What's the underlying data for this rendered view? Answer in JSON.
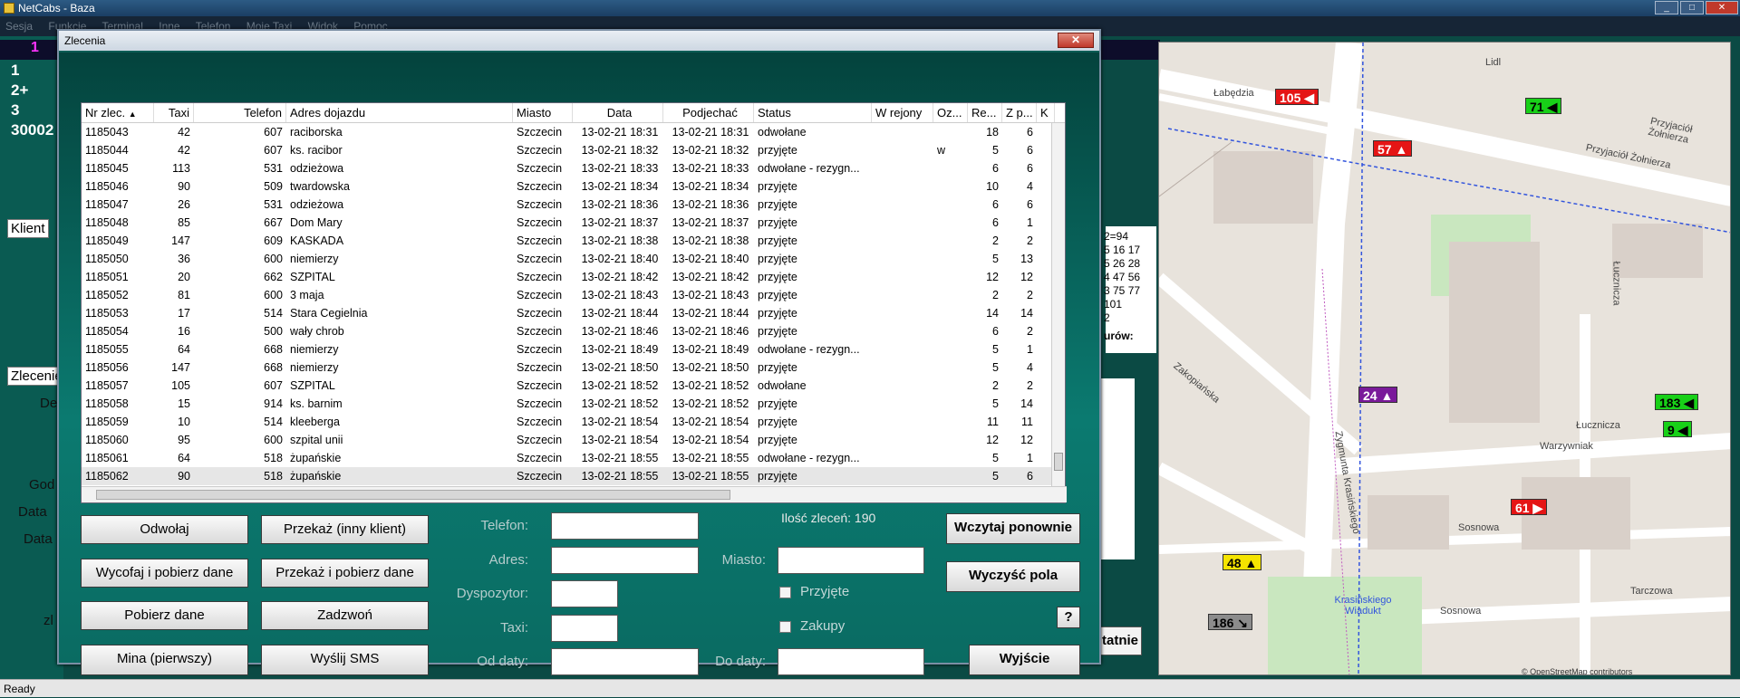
{
  "window": {
    "title": "NetCabs - Baza",
    "min": "_",
    "max": "□",
    "close": "✕"
  },
  "menu": [
    "Sesja",
    "Funkcje",
    "Terminal",
    "Inne",
    "Telefon",
    "Moje Taxi",
    "Widok",
    "Pomoc"
  ],
  "left_panel": {
    "tab_number": "1",
    "list": [
      "1",
      "2+",
      "3",
      "30002"
    ],
    "klient_label": "Klient",
    "zlecenie_label": "Zlecenie",
    "labels": [
      "De",
      "God",
      "Data",
      "Data",
      "zl"
    ]
  },
  "background_right": {
    "values_text": "2=94\n5 16 17\n5 26 28\n4 47 56\n3 75 77\n101\n2",
    "caption": "urów:",
    "button": "tatnie"
  },
  "dialog": {
    "title": "Zlecenia",
    "close": "✕",
    "columns": [
      "Nr zlec.",
      "Taxi",
      "Telefon",
      "Adres dojazdu",
      "Miasto",
      "Data",
      "Podjechać",
      "Status",
      "W rejony",
      "Oz...",
      "Re...",
      "Z p...",
      "K"
    ],
    "rows": [
      [
        "1185043",
        "42",
        "607",
        "raciborska",
        "Szczecin",
        "13-02-21 18:31",
        "13-02-21 18:31",
        "odwołane",
        "",
        "",
        "18",
        "6"
      ],
      [
        "1185044",
        "42",
        "607",
        "ks. racibor",
        "Szczecin",
        "13-02-21 18:32",
        "13-02-21 18:32",
        "przyjęte",
        "",
        "w",
        "5",
        "6"
      ],
      [
        "1185045",
        "113",
        "531",
        "odzieżowa",
        "Szczecin",
        "13-02-21 18:33",
        "13-02-21 18:33",
        "odwołane - rezygn...",
        "",
        "",
        "6",
        "6"
      ],
      [
        "1185046",
        "90",
        "509",
        "twardowska",
        "Szczecin",
        "13-02-21 18:34",
        "13-02-21 18:34",
        "przyjęte",
        "",
        "",
        "10",
        "4"
      ],
      [
        "1185047",
        "26",
        "531",
        "odzieżowa",
        "Szczecin",
        "13-02-21 18:36",
        "13-02-21 18:36",
        "przyjęte",
        "",
        "",
        "6",
        "6"
      ],
      [
        "1185048",
        "85",
        "667",
        "Dom Mary",
        "Szczecin",
        "13-02-21 18:37",
        "13-02-21 18:37",
        "przyjęte",
        "",
        "",
        "6",
        "1"
      ],
      [
        "1185049",
        "147",
        "609",
        "KASKADA",
        "Szczecin",
        "13-02-21 18:38",
        "13-02-21 18:38",
        "przyjęte",
        "",
        "",
        "2",
        "2"
      ],
      [
        "1185050",
        "36",
        "600",
        "niemierzy",
        "Szczecin",
        "13-02-21 18:40",
        "13-02-21 18:40",
        "przyjęte",
        "",
        "",
        "5",
        "13"
      ],
      [
        "1185051",
        "20",
        "662",
        "SZPITAL",
        "Szczecin",
        "13-02-21 18:42",
        "13-02-21 18:42",
        "przyjęte",
        "",
        "",
        "12",
        "12"
      ],
      [
        "1185052",
        "81",
        "600",
        "3 maja",
        "Szczecin",
        "13-02-21 18:43",
        "13-02-21 18:43",
        "przyjęte",
        "",
        "",
        "2",
        "2"
      ],
      [
        "1185053",
        "17",
        "514",
        "Stara Cegielnia",
        "Szczecin",
        "13-02-21 18:44",
        "13-02-21 18:44",
        "przyjęte",
        "",
        "",
        "14",
        "14"
      ],
      [
        "1185054",
        "16",
        "500",
        "wały chrob",
        "Szczecin",
        "13-02-21 18:46",
        "13-02-21 18:46",
        "przyjęte",
        "",
        "",
        "6",
        "2"
      ],
      [
        "1185055",
        "64",
        "668",
        "niemierzy",
        "Szczecin",
        "13-02-21 18:49",
        "13-02-21 18:49",
        "odwołane - rezygn...",
        "",
        "",
        "5",
        "1"
      ],
      [
        "1185056",
        "147",
        "668",
        "niemierzy",
        "Szczecin",
        "13-02-21 18:50",
        "13-02-21 18:50",
        "przyjęte",
        "",
        "",
        "5",
        "4"
      ],
      [
        "1185057",
        "105",
        "607",
        "SZPITAL",
        "Szczecin",
        "13-02-21 18:52",
        "13-02-21 18:52",
        "odwołane",
        "",
        "",
        "2",
        "2"
      ],
      [
        "1185058",
        "15",
        "914",
        "ks. barnim",
        "Szczecin",
        "13-02-21 18:52",
        "13-02-21 18:52",
        "przyjęte",
        "",
        "",
        "5",
        "14"
      ],
      [
        "1185059",
        "10",
        "514",
        "kleeberga",
        "Szczecin",
        "13-02-21 18:54",
        "13-02-21 18:54",
        "przyjęte",
        "",
        "",
        "11",
        "11"
      ],
      [
        "1185060",
        "95",
        "600",
        "szpital unii",
        "Szczecin",
        "13-02-21 18:54",
        "13-02-21 18:54",
        "przyjęte",
        "",
        "",
        "12",
        "12"
      ],
      [
        "1185061",
        "64",
        "518",
        "żupańskie",
        "Szczecin",
        "13-02-21 18:55",
        "13-02-21 18:55",
        "odwołane - rezygn...",
        "",
        "",
        "5",
        "1"
      ],
      [
        "1185062",
        "90",
        "518",
        "żupańskie",
        "Szczecin",
        "13-02-21 18:55",
        "13-02-21 18:55",
        "przyjęte",
        "",
        "",
        "5",
        "6"
      ]
    ],
    "buttons": {
      "odwolaj": "Odwołaj",
      "przekaz_inny": "Przekaż (inny klient)",
      "wycofaj": "Wycofaj i pobierz dane",
      "przekaz_pobierz": "Przekaż i pobierz dane",
      "pobierz": "Pobierz dane",
      "zadzwon": "Zadzwoń",
      "mina": "Mina (pierwszy)",
      "sms": "Wyślij SMS",
      "wczytaj": "Wczytaj ponownie",
      "wyczysc": "Wyczyść pola",
      "help": "?",
      "wyjscie": "Wyjście"
    },
    "filters": {
      "telefon": "Telefon:",
      "adres": "Adres:",
      "miasto": "Miasto:",
      "dyspozytor": "Dyspozytor:",
      "taxi": "Taxi:",
      "od_daty": "Od daty:",
      "do_daty": "Do daty:",
      "przyjete": "Przyjęte",
      "zakupy": "Zakupy"
    },
    "count": "Ilość zleceń: 190"
  },
  "map": {
    "taxis": [
      {
        "label": "105",
        "color": "red"
      },
      {
        "label": "71",
        "color": "green"
      },
      {
        "label": "57",
        "color": "red"
      },
      {
        "label": "24",
        "color": "purple"
      },
      {
        "label": "183",
        "color": "green"
      },
      {
        "label": "9",
        "color": "green"
      },
      {
        "label": "61",
        "color": "red"
      },
      {
        "label": "48",
        "color": "yellow"
      },
      {
        "label": "186",
        "color": "gray"
      }
    ],
    "streets": [
      "Łabędzia",
      "Przyjaciół Żołnierza",
      "Zakopiańska",
      "Łucznicza",
      "Sosnowa",
      "Tarczowa",
      "Zygmunta Krasińskiego",
      "Lidl",
      "Warzywniak",
      "Krasińskiego Wiadukt"
    ],
    "attribution": "© OpenStreetMap contributors"
  },
  "status": "Ready"
}
